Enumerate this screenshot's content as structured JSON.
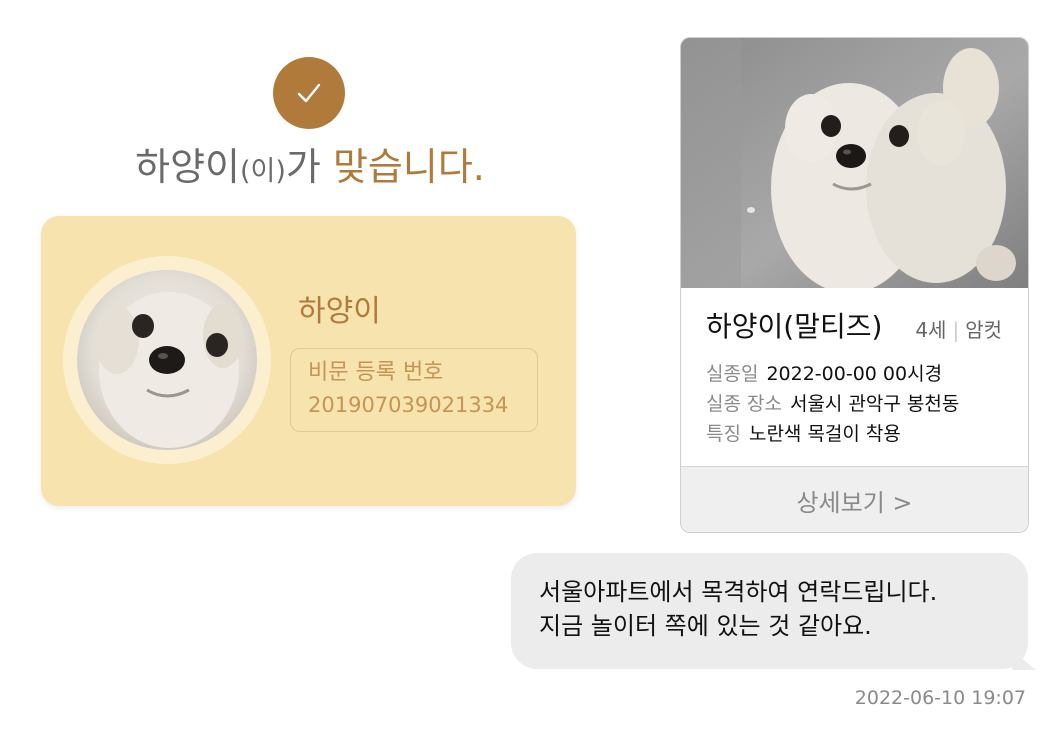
{
  "confirmation": {
    "name": "하양이",
    "particle": "(이)",
    "ga": "가 ",
    "accent_text": "맞습니다.",
    "accent_color": "#b07a3a",
    "check_icon": "checkmark-icon"
  },
  "id_card": {
    "name": "하양이",
    "reg_label": "비문 등록 번호",
    "reg_number": "201907039021334",
    "background_color": "#f6e3ae"
  },
  "post": {
    "title": "하양이(말티즈)",
    "age": "4세",
    "separator": "|",
    "sex": "암컷",
    "lost_date_label": "실종일",
    "lost_date_value": "2022-00-00 00시경",
    "lost_place_label": "실종 장소",
    "lost_place_value": "서울시 관악구 봉천동",
    "feature_label": "특징",
    "feature_value": "노란색 목걸이 착용",
    "detail_button_label": "상세보기 >"
  },
  "message": {
    "line1": "서울아파트에서 목격하여 연락드립니다.",
    "line2": "지금 놀이터 쪽에 있는 것 같아요.",
    "timestamp": "2022-06-10  19:07"
  }
}
